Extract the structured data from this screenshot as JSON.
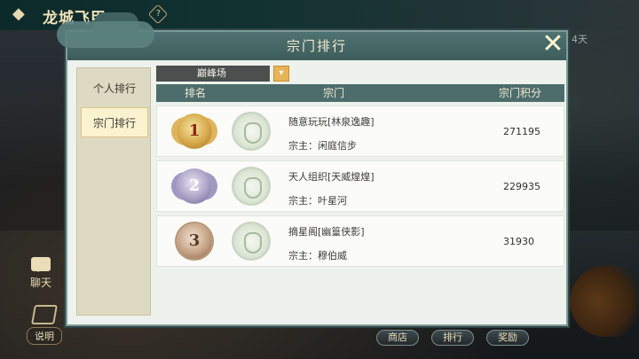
{
  "header": {
    "title": "龙城飞甲",
    "help_icon": "?"
  },
  "top_right_text": "4天",
  "side": {
    "chat_label": "聊天",
    "help_label": "说明"
  },
  "bottom_buttons": [
    "商店",
    "排行",
    "奖励"
  ],
  "dialog": {
    "title": "宗门排行",
    "close_icon": "close-x",
    "tabs": [
      {
        "label": "个人排行",
        "active": false
      },
      {
        "label": "宗门排行",
        "active": true
      }
    ],
    "dropdown": {
      "selected": "巅峰场",
      "arrow": "▾"
    },
    "table": {
      "headers": {
        "rank": "排名",
        "sect": "宗门",
        "score": "宗门积分"
      },
      "rows": [
        {
          "rank": "1",
          "medal": "gold",
          "name": "随意玩玩[林泉逸趣]",
          "leader": "宗主：闲庭信步",
          "score": "271195"
        },
        {
          "rank": "2",
          "medal": "silver",
          "name": "天人组织[天威煌煌]",
          "leader": "宗主：叶星河",
          "score": "229935"
        },
        {
          "rank": "3",
          "medal": "bronze",
          "name": "摘星阁[幽篁侠影]",
          "leader": "宗主：穆伯威",
          "score": "31930"
        }
      ]
    }
  }
}
